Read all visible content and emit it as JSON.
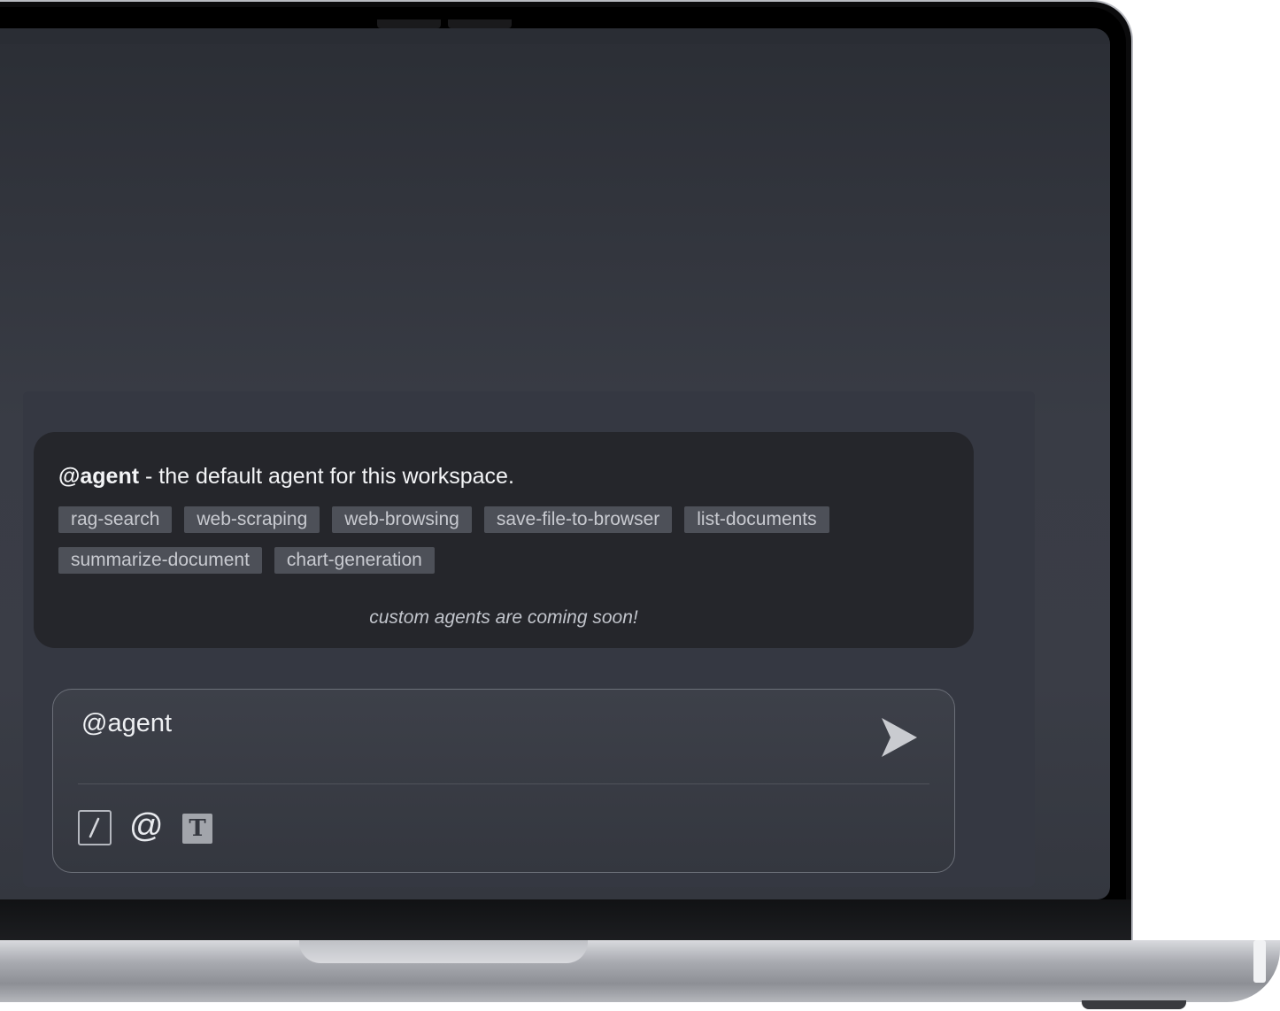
{
  "agent": {
    "name": "@agent",
    "description": " - the default agent for this workspace.",
    "skills_row1": [
      "rag-search",
      "web-scraping",
      "web-browsing",
      "save-file-to-browser",
      "list-documents"
    ],
    "skills_row2": [
      "summarize-document",
      "chart-generation"
    ],
    "note": "custom agents are coming soon!"
  },
  "prompt": {
    "value": "@agent"
  },
  "toolbar": {
    "icons": [
      "slash-command-icon",
      "at-mention-icon",
      "text-size-icon"
    ],
    "at_glyph": "@",
    "t_glyph": "T"
  },
  "colors": {
    "screen_bg": "#393c45",
    "card_bg": "#25262b",
    "chip_bg": "#4d5058"
  }
}
